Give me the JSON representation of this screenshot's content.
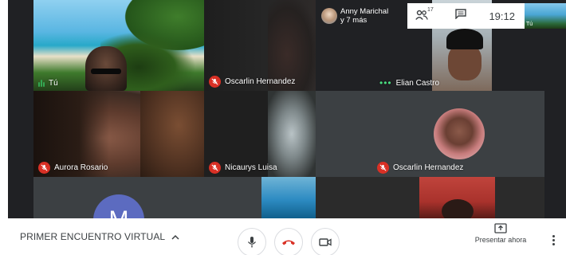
{
  "participants": {
    "self": {
      "label": "Tú"
    },
    "oscarlin_top": {
      "label": "Oscarlin Hernandez",
      "muted": true
    },
    "elian": {
      "label": "Elian Castro",
      "speaking": true
    },
    "aurora": {
      "label": "Aurora Rosario",
      "muted": true
    },
    "nicaurys": {
      "label": "Nicaurys Luisa",
      "muted": true
    },
    "oscarlin_mid": {
      "label": "Oscarlin Hernandez",
      "muted": true
    },
    "m_avatar": {
      "initial": "M",
      "color": "#5c6bc0"
    }
  },
  "header": {
    "presenter_name": "Anny Marichal",
    "presenter_more": "y 7 más",
    "people_count": "17",
    "time": "19:12",
    "self_thumb_label": "Tú"
  },
  "controls": {
    "meeting_title": "PRIMER ENCUENTRO VIRTUAL",
    "present_label": "Presentar ahora"
  },
  "colors": {
    "muted_badge": "#d93025",
    "hangup": "#d93025",
    "speaking": "#4ade80",
    "tile_bg": "#3c4043"
  },
  "icons": [
    "mic-icon",
    "hangup-icon",
    "camera-icon",
    "present-icon",
    "more-vert-icon",
    "people-icon",
    "chat-icon",
    "chevron-up-icon",
    "mic-off-icon"
  ]
}
